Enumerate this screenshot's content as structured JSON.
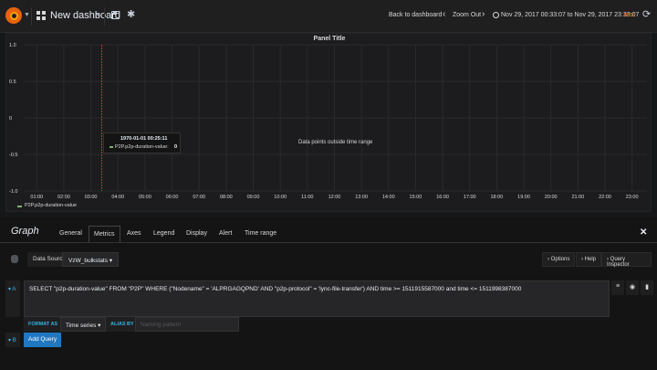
{
  "topbar": {
    "dashboard_title": "New dashboard",
    "back_link": "Back to dashboard",
    "zoom_out": "Zoom Out",
    "time_range": "Nov 29, 2017 00:33:07 to Nov 29, 2017 23:33:07",
    "timezone": "UTC",
    "icons": [
      "grafana-logo-icon",
      "caret-down-icon",
      "dashboard-grid-icon",
      "save-icon",
      "gear-icon",
      "chevron-left-icon",
      "chevron-right-icon",
      "clock-icon",
      "refresh-icon"
    ]
  },
  "panel": {
    "title": "Panel Title",
    "outside_message": "Data points outside time range",
    "tooltip": {
      "time": "1970-01-01 00:25:11",
      "series": "P2P.p2p-duration-value:",
      "value": "0"
    },
    "legend": [
      "P2P.p2p-duration-value"
    ]
  },
  "chart_data": {
    "type": "line",
    "series": [
      {
        "name": "P2P.p2p-duration-value",
        "values": []
      }
    ],
    "xlabel": "",
    "ylabel": "",
    "ylim": [
      -1.0,
      1.0
    ],
    "yticks": [
      "1.0",
      "0.5",
      "0",
      "-0.5",
      "-1.0"
    ],
    "xticks": [
      "01:00",
      "02:00",
      "03:00",
      "04:00",
      "05:00",
      "06:00",
      "07:00",
      "08:00",
      "09:00",
      "10:00",
      "11:00",
      "12:00",
      "13:00",
      "14:00",
      "15:00",
      "16:00",
      "17:00",
      "18:00",
      "19:00",
      "20:00",
      "21:00",
      "22:00",
      "23:00"
    ],
    "xlim_hours": [
      0.5517,
      23.5517
    ],
    "crosshair_hour": 3.4,
    "grid": true,
    "legend_position": "bottom-left",
    "colors": {
      "series": "#7eb26d",
      "crosshair": "#cc3333",
      "grid": "#2a2a2c"
    }
  },
  "editor": {
    "title": "Graph",
    "tabs": [
      "General",
      "Metrics",
      "Axes",
      "Legend",
      "Display",
      "Alert",
      "Time range"
    ],
    "active_tab": "Metrics",
    "datasource_label": "Data Source",
    "datasource_value": "VzW_bulkstats",
    "options_label": "Options",
    "help_label": "Help",
    "query_inspector_label": "Query Inspector",
    "query_letter_a": "A",
    "query_text": "SELECT \"p2p-duration-value\" FROM \"P2P\" WHERE (\"Nodename\" = 'ALPRGAGQPND' AND \"p2p-protocol\" = 'lync-file-transfer') AND time >= 1511915587000 and time <= 1511998387000",
    "format_as_label": "FORMAT AS",
    "format_as_value": "Time series",
    "alias_by_label": "ALIAS BY",
    "alias_placeholder": "Naming pattern",
    "query_letter_b": "B",
    "add_query": "Add Query"
  }
}
